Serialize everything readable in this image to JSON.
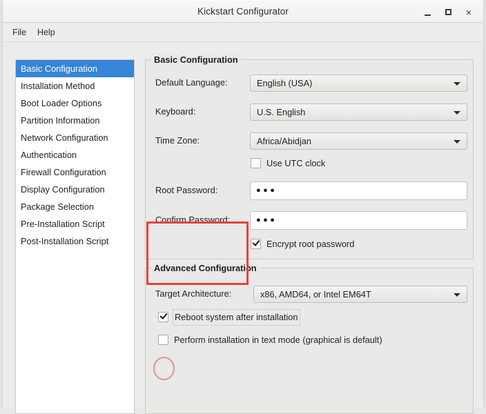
{
  "window": {
    "title": "Kickstart Configurator",
    "controls": {
      "minimize": "minimize-icon",
      "maximize": "maximize-icon",
      "close": "×"
    }
  },
  "menubar": {
    "items": [
      {
        "label": "File"
      },
      {
        "label": "Help"
      }
    ]
  },
  "sidebar": {
    "items": [
      {
        "label": "Basic Configuration",
        "selected": true
      },
      {
        "label": "Installation Method",
        "selected": false
      },
      {
        "label": "Boot Loader Options",
        "selected": false
      },
      {
        "label": "Partition Information",
        "selected": false
      },
      {
        "label": "Network Configuration",
        "selected": false
      },
      {
        "label": "Authentication",
        "selected": false
      },
      {
        "label": "Firewall Configuration",
        "selected": false
      },
      {
        "label": "Display Configuration",
        "selected": false
      },
      {
        "label": "Package Selection",
        "selected": false
      },
      {
        "label": "Pre-Installation Script",
        "selected": false
      },
      {
        "label": "Post-Installation Script",
        "selected": false
      }
    ]
  },
  "basic_configuration": {
    "legend": "Basic Configuration",
    "default_language": {
      "label": "Default Language:",
      "value": "English (USA)"
    },
    "keyboard": {
      "label": "Keyboard:",
      "value": "U.S. English"
    },
    "time_zone": {
      "label": "Time Zone:",
      "value": "Africa/Abidjan"
    },
    "use_utc_clock": {
      "label": "Use UTC clock",
      "checked": false
    },
    "root_password": {
      "label": "Root Password:",
      "value": "●●●"
    },
    "confirm_password": {
      "label": "Confirm Password:",
      "value": "●●●"
    },
    "encrypt_root_password": {
      "label": "Encrypt root password",
      "checked": true
    }
  },
  "advanced_configuration": {
    "legend": "Advanced Configuration",
    "target_architecture": {
      "label": "Target Architecture:",
      "value": "x86, AMD64, or Intel EM64T"
    },
    "reboot_after_install": {
      "label": "Reboot system after installation",
      "checked": true
    },
    "text_mode_install": {
      "label": "Perform installation in text mode (graphical is default)",
      "checked": false
    }
  },
  "annotations": {
    "password_highlight_color": "#e8413a",
    "reboot_circle_color": "#e78f94"
  },
  "colors": {
    "selection_blue": "#3586d8",
    "window_bg": "#ececea",
    "panel_bg": "#e9e9e7",
    "list_bg": "#ffffff"
  }
}
